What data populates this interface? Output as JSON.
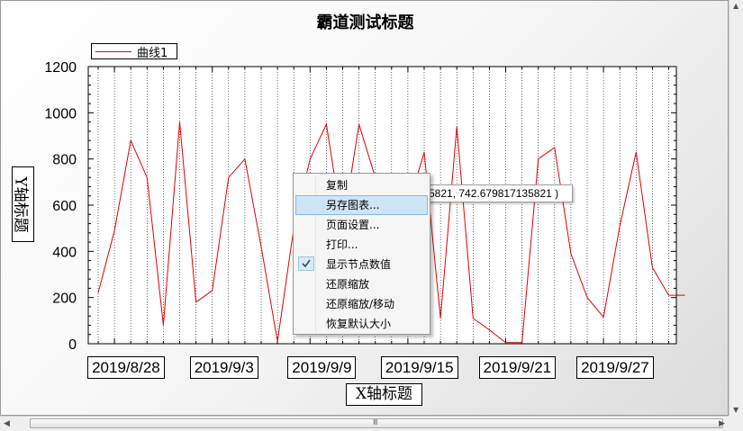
{
  "chart_data": {
    "type": "line",
    "title": "霸道测试标题",
    "xlabel": "X轴标题",
    "ylabel": "Y轴标题",
    "x": [
      "2019/8/27",
      "2019/8/28",
      "2019/8/29",
      "2019/8/30",
      "2019/8/31",
      "2019/9/1",
      "2019/9/2",
      "2019/9/3",
      "2019/9/4",
      "2019/9/5",
      "2019/9/6",
      "2019/9/7",
      "2019/9/8",
      "2019/9/9",
      "2019/9/10",
      "2019/9/11",
      "2019/9/12",
      "2019/9/13",
      "2019/9/14",
      "2019/9/15",
      "2019/9/16",
      "2019/9/17",
      "2019/9/18",
      "2019/9/19",
      "2019/9/20",
      "2019/9/21",
      "2019/9/22",
      "2019/9/23",
      "2019/9/24",
      "2019/9/25",
      "2019/9/26",
      "2019/9/27",
      "2019/9/28",
      "2019/9/29",
      "2019/9/30",
      "2019/10/1",
      "2019/10/2"
    ],
    "series": [
      {
        "name": "曲线1",
        "values": [
          220,
          490,
          880,
          720,
          80,
          960,
          180,
          230,
          720,
          800,
          420,
          10,
          500,
          800,
          950,
          500,
          950,
          720,
          600,
          590,
          830,
          110,
          940,
          110,
          60,
          5,
          5,
          800,
          850,
          390,
          200,
          115,
          510,
          830,
          330,
          210,
          210
        ]
      }
    ],
    "xticks": [
      "2019/8/28",
      "2019/9/3",
      "2019/9/9",
      "2019/9/15",
      "2019/9/21",
      "2019/9/27"
    ],
    "yticks": [
      0,
      200,
      400,
      600,
      800,
      1000,
      1200
    ],
    "ylim": [
      0,
      1200
    ],
    "grid": "vertical-dotted",
    "legend_position": "top-left",
    "line_color": "#e00000"
  },
  "tooltip": "5821, 742.679817135821 )",
  "context_menu": {
    "items": [
      {
        "label": "复制",
        "checked": false,
        "highlighted": false
      },
      {
        "label": "另存图表...",
        "checked": false,
        "highlighted": true
      },
      {
        "label": "页面设置...",
        "checked": false,
        "highlighted": false
      },
      {
        "label": "打印...",
        "checked": false,
        "highlighted": false
      },
      {
        "label": "显示节点数值",
        "checked": true,
        "highlighted": false
      },
      {
        "label": "还原缩放",
        "checked": false,
        "highlighted": false
      },
      {
        "label": "还原缩放/移动",
        "checked": false,
        "highlighted": false
      },
      {
        "label": "恢复默认大小",
        "checked": false,
        "highlighted": false
      }
    ]
  },
  "scrollbars": {
    "horizontal_grip": "Ⅲ"
  }
}
